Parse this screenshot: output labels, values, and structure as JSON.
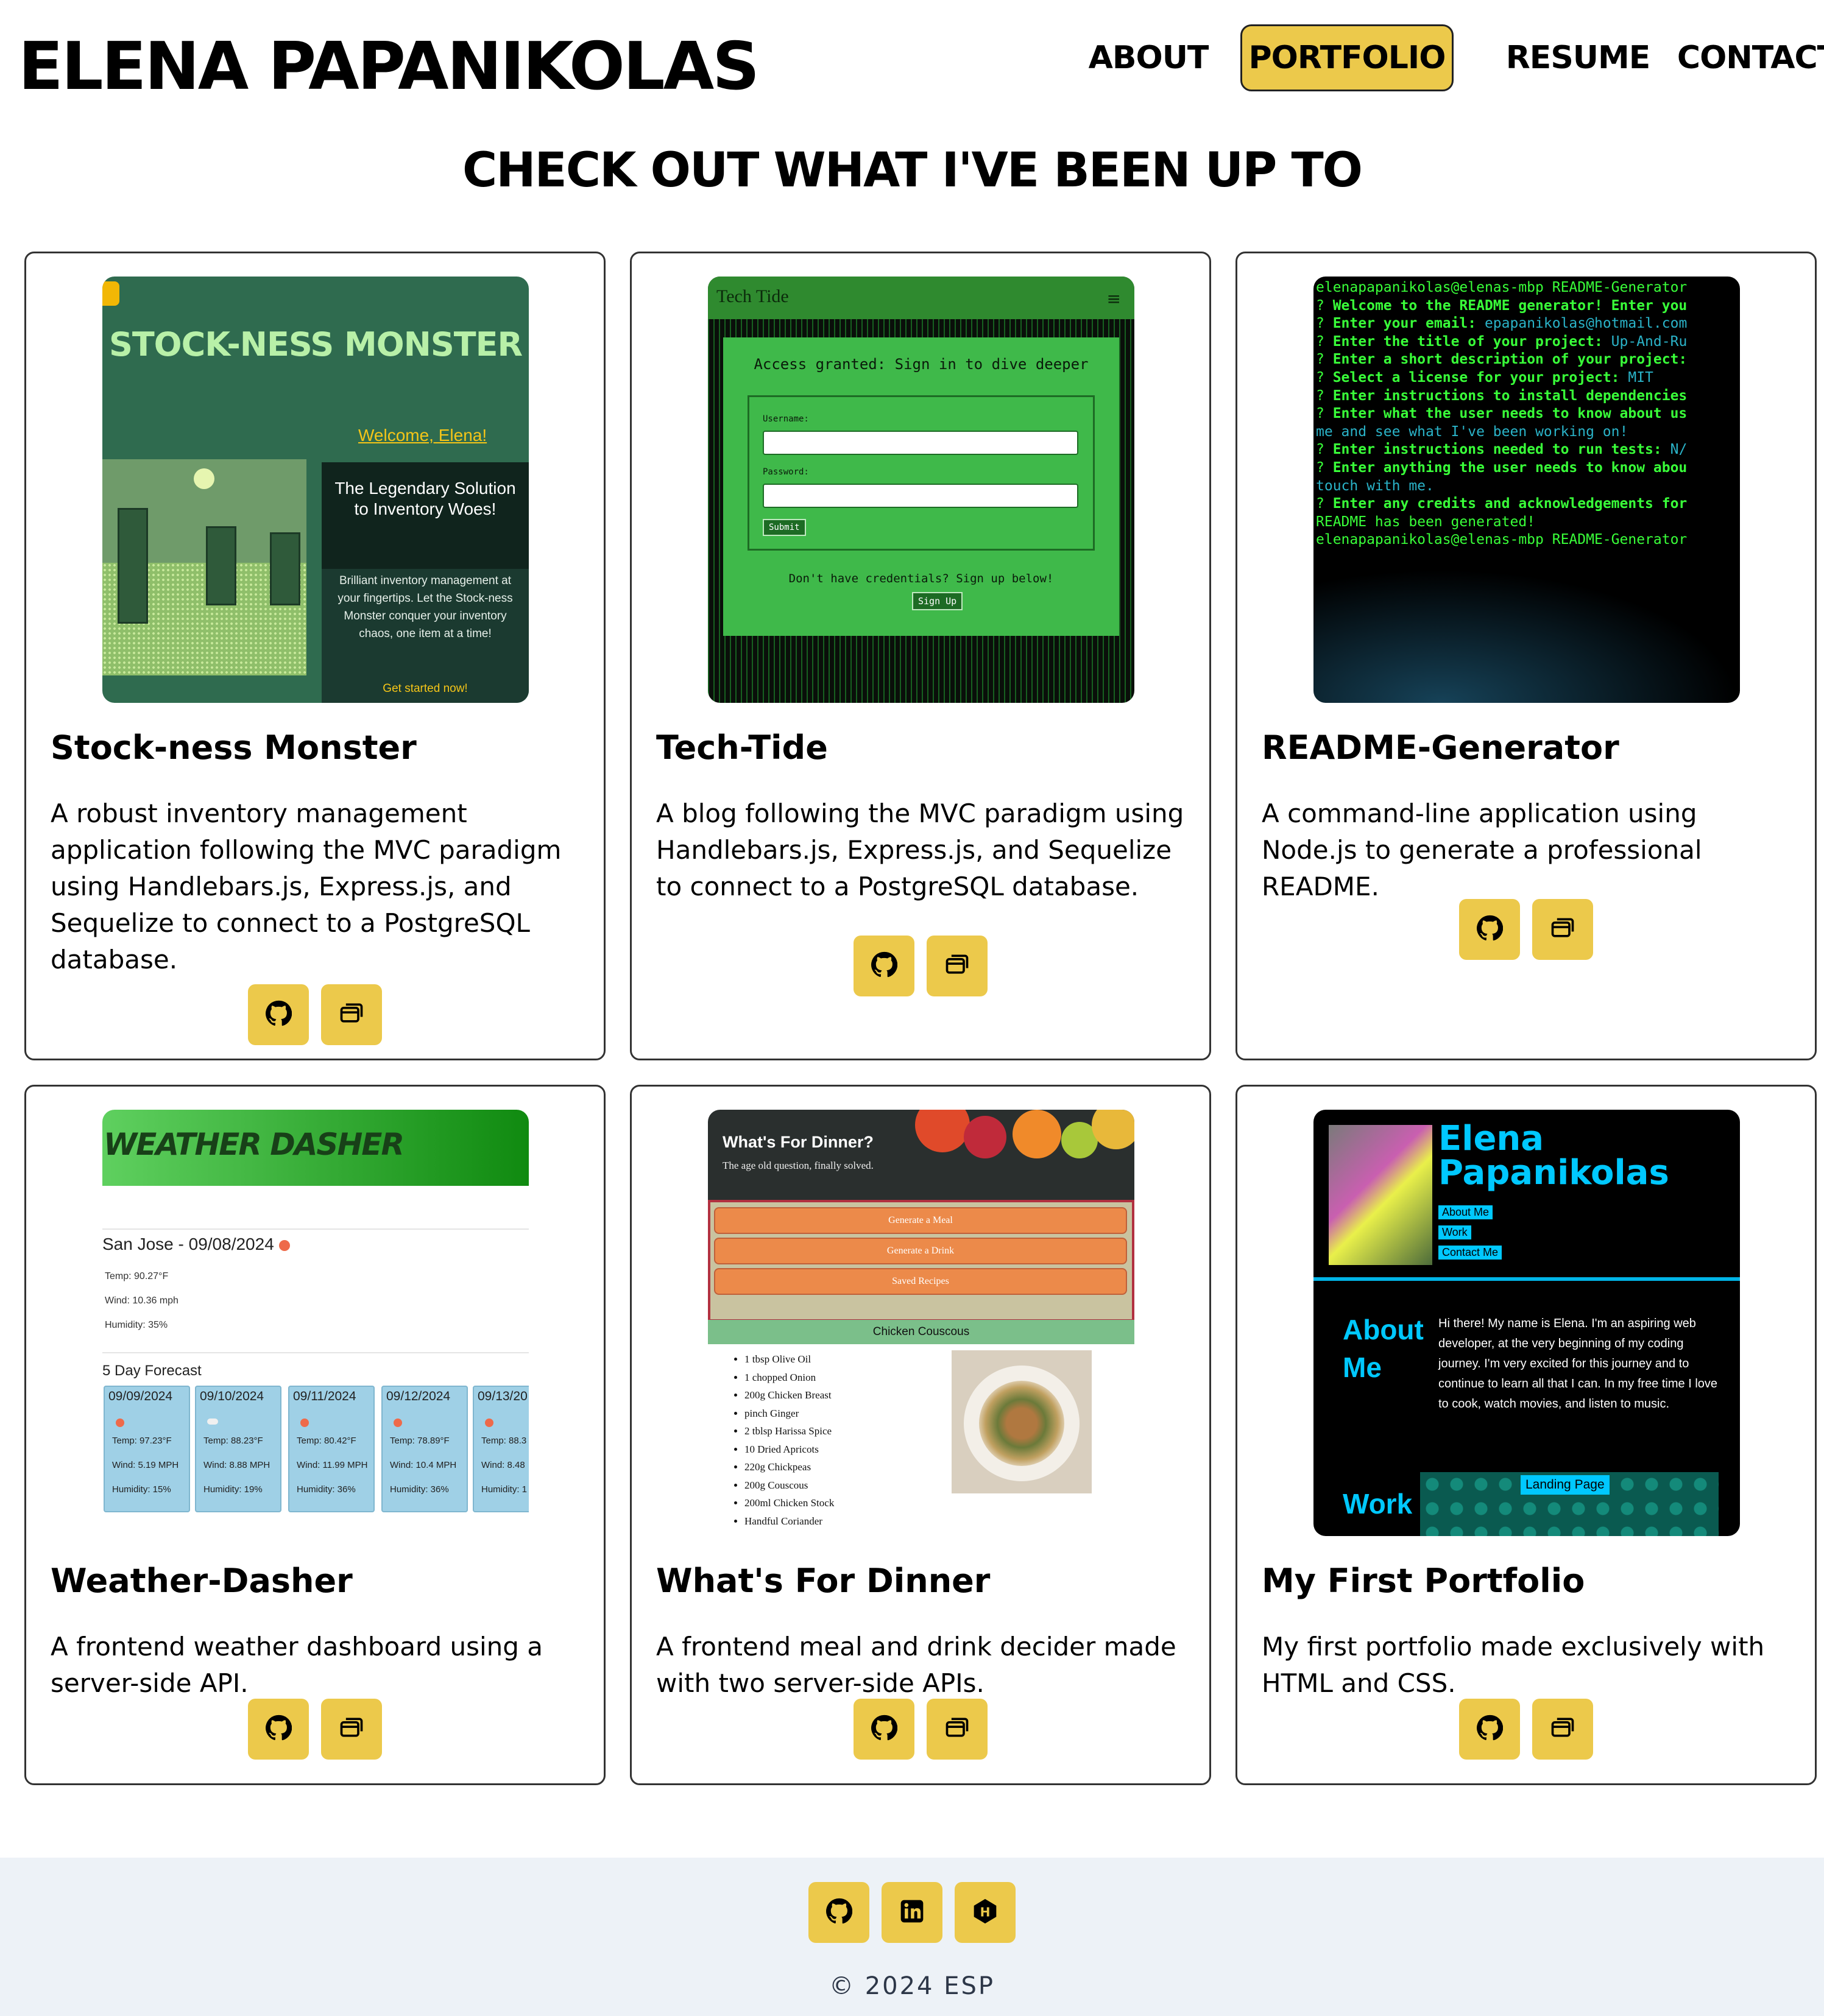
{
  "header": {
    "site_name": "ELENA PAPANIKOLAS",
    "nav": [
      {
        "label": "ABOUT",
        "active": false
      },
      {
        "label": "PORTFOLIO",
        "active": true
      },
      {
        "label": "RESUME",
        "active": false
      },
      {
        "label": "CONTACT",
        "active": false
      }
    ]
  },
  "heading": "CHECK OUT WHAT I'VE BEEN UP TO",
  "colors": {
    "accent": "#ecc94b",
    "footer_bg": "#edf2f7"
  },
  "projects": [
    {
      "title": "Stock-ness Monster",
      "description": "A robust inventory management application following the MVC paradigm using Handlebars.js, Express.js, and Sequelize to connect to a PostgreSQL database.",
      "buttons": [
        "github-icon",
        "browser-windows-icon"
      ]
    },
    {
      "title": "Tech-Tide",
      "description": "A blog following the MVC paradigm using Handlebars.js, Express.js, and Sequelize to connect to a PostgreSQL database.",
      "buttons": [
        "github-icon",
        "browser-windows-icon"
      ]
    },
    {
      "title": "README-Generator",
      "description": "A command-line application using Node.js to generate a professional README.",
      "buttons": [
        "github-icon",
        "browser-windows-icon"
      ]
    },
    {
      "title": "Weather-Dasher",
      "description": "A frontend weather dashboard using a server-side API.",
      "buttons": [
        "github-icon",
        "browser-windows-icon"
      ]
    },
    {
      "title": "What's For Dinner",
      "description": "A frontend meal and drink decider made with two server-side APIs.",
      "buttons": [
        "github-icon",
        "browser-windows-icon"
      ]
    },
    {
      "title": "My First Portfolio",
      "description": "My first portfolio made exclusively with HTML and CSS.",
      "buttons": [
        "github-icon",
        "browser-windows-icon"
      ]
    }
  ],
  "shots": {
    "stockness": {
      "logo": "STOCK-NESS MONSTER",
      "welcome": "Welcome, Elena!",
      "headline": "The Legendary Solution to Inventory Woes!",
      "body": "Brilliant inventory management at your fingertips. Let the Stock-ness Monster conquer your inventory chaos, one item at a time!",
      "cta": "Get started now!"
    },
    "techtide": {
      "brand": "Tech Tide",
      "menu": "≡",
      "heading": "Access granted: Sign in to dive deeper",
      "username_label": "Username:",
      "password_label": "Password:",
      "submit": "Submit",
      "prompt": "Don't have credentials? Sign up below!",
      "signup": "Sign Up"
    },
    "readme": {
      "lines": [
        [
          {
            "t": "elenapapanikolas@elenas-mbp README-Generator",
            "c": "g"
          }
        ],
        [
          {
            "t": "? ",
            "c": "g"
          },
          {
            "t": "Welcome to the README generator! Enter you",
            "c": "gw"
          }
        ],
        [
          {
            "t": "? ",
            "c": "g"
          },
          {
            "t": "Enter your email: ",
            "c": "gw"
          },
          {
            "t": "epapanikolas@hotmail.com",
            "c": "c"
          }
        ],
        [
          {
            "t": "? ",
            "c": "g"
          },
          {
            "t": "Enter the title of your project: ",
            "c": "gw"
          },
          {
            "t": "Up-And-Ru",
            "c": "c"
          }
        ],
        [
          {
            "t": "? ",
            "c": "g"
          },
          {
            "t": "Enter a short description of your project:",
            "c": "gw"
          }
        ],
        [
          {
            "t": "? ",
            "c": "g"
          },
          {
            "t": "Select a license for your project: ",
            "c": "gw"
          },
          {
            "t": "MIT",
            "c": "c"
          }
        ],
        [
          {
            "t": "? ",
            "c": "g"
          },
          {
            "t": "Enter instructions to install dependencies",
            "c": "gw"
          }
        ],
        [
          {
            "t": "? ",
            "c": "g"
          },
          {
            "t": "Enter what the user needs to know about us",
            "c": "gw"
          }
        ],
        [
          {
            "t": "me and see what I've been working on!",
            "c": "c"
          }
        ],
        [
          {
            "t": "? ",
            "c": "g"
          },
          {
            "t": "Enter instructions needed to run tests: ",
            "c": "gw"
          },
          {
            "t": "N/",
            "c": "c"
          }
        ],
        [
          {
            "t": "? ",
            "c": "g"
          },
          {
            "t": "Enter anything the user needs to know abou",
            "c": "gw"
          }
        ],
        [
          {
            "t": "touch with me.",
            "c": "c"
          }
        ],
        [
          {
            "t": "? ",
            "c": "g"
          },
          {
            "t": "Enter any credits and acknowledgements for",
            "c": "gw"
          }
        ],
        [
          {
            "t": "README has been generated!",
            "c": "g"
          }
        ],
        [
          {
            "t": "elenapapanikolas@elenas-mbp README-Generator",
            "c": "g"
          }
        ]
      ]
    },
    "weather": {
      "title": "WEATHER DASHER",
      "city": "San Jose - 09/08/2024",
      "temp": "Temp: 90.27°F",
      "wind": "Wind: 10.36 mph",
      "humidity": "Humidity: 35%",
      "forecast_label": "5 Day Forecast",
      "days": [
        {
          "date": "09/09/2024",
          "temp": "Temp: 97.23°F",
          "wind": "Wind: 5.19 MPH",
          "hum": "Humidity: 15%",
          "icon": "sun"
        },
        {
          "date": "09/10/2024",
          "temp": "Temp: 88.23°F",
          "wind": "Wind: 8.88 MPH",
          "hum": "Humidity: 19%",
          "icon": "cloud"
        },
        {
          "date": "09/11/2024",
          "temp": "Temp: 80.42°F",
          "wind": "Wind: 11.99 MPH",
          "hum": "Humidity: 36%",
          "icon": "sun"
        },
        {
          "date": "09/12/2024",
          "temp": "Temp: 78.89°F",
          "wind": "Wind: 10.4 MPH",
          "hum": "Humidity: 36%",
          "icon": "sun"
        },
        {
          "date": "09/13/20",
          "temp": "Temp: 88.3",
          "wind": "Wind: 8.48",
          "hum": "Humidity: 1",
          "icon": "sun"
        }
      ]
    },
    "dinner": {
      "title": "What's For Dinner?",
      "subtitle": "The age old question, finally solved.",
      "buttons": [
        "Generate a Meal",
        "Generate a Drink",
        "Saved Recipes"
      ],
      "recipe_title": "Chicken Couscous",
      "ingredients": [
        "1 tbsp Olive Oil",
        "1 chopped Onion",
        "200g Chicken Breast",
        "pinch Ginger",
        "2 tblsp Harissa Spice",
        "10 Dried Apricots",
        "220g Chickpeas",
        "200g Couscous",
        "200ml Chicken Stock",
        "Handful Coriander"
      ]
    },
    "firstportfolio": {
      "name": "Elena Papanikolas",
      "nav": [
        "About Me",
        "Work",
        "Contact Me"
      ],
      "about_heading": "About Me",
      "bio": "Hi there! My name is Elena. I'm an aspiring web developer, at the very beginning of my coding journey. I'm very excited for this journey and to continue to learn all that I can. In my free time I love to cook, watch movies, and listen to music.",
      "work_heading": "Work",
      "landing": "Landing Page"
    }
  },
  "footer": {
    "icons": [
      "github-icon",
      "linkedin-icon",
      "hashnode-icon"
    ],
    "copyright": "© 2024 ESP"
  }
}
